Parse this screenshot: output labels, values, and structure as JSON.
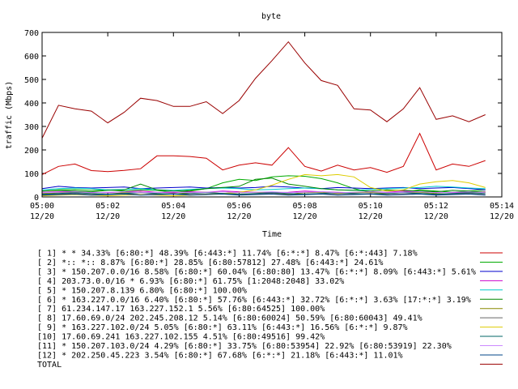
{
  "chart_data": {
    "type": "line",
    "title": "byte",
    "xlabel": "Time",
    "ylabel": "traffic (Mbps)",
    "ylim": [
      0,
      700
    ],
    "yticks": [
      0,
      100,
      200,
      300,
      400,
      500,
      600,
      700
    ],
    "xlim": [
      0,
      28
    ],
    "xticks": [
      {
        "x": 0,
        "label1": "05:00",
        "label2": "12/20"
      },
      {
        "x": 4,
        "label1": "05:02",
        "label2": "12/20"
      },
      {
        "x": 8,
        "label1": "05:04",
        "label2": "12/20"
      },
      {
        "x": 12,
        "label1": "05:06",
        "label2": "12/20"
      },
      {
        "x": 16,
        "label1": "05:08",
        "label2": "12/20"
      },
      {
        "x": 20,
        "label1": "05:10",
        "label2": "12/20"
      },
      {
        "x": 24,
        "label1": "05:12",
        "label2": "12/20"
      },
      {
        "x": 28,
        "label1": "05:14",
        "label2": "12/20"
      }
    ],
    "x": [
      0,
      1,
      2,
      3,
      4,
      5,
      6,
      7,
      8,
      9,
      10,
      11,
      12,
      13,
      14,
      15,
      16,
      17,
      18,
      19,
      20,
      21,
      22,
      23,
      24,
      25,
      26,
      27
    ],
    "series": [
      {
        "legend": "[ 1] * * 34.33%  [6:80:*] 48.39% [6:443:*] 11.74% [6:*:*] 8.47% [6:*:443] 7.18%",
        "color": "#cc0000",
        "values": [
          95,
          130,
          140,
          112,
          108,
          113,
          120,
          175,
          175,
          172,
          165,
          115,
          135,
          145,
          135,
          210,
          130,
          110,
          135,
          115,
          125,
          105,
          130,
          270,
          115,
          140,
          130,
          155
        ]
      },
      {
        "legend": "[ 2] *:: *:: 8.87%  [6:80:*] 28.85% [6:80:57812] 27.48% [6:443:*] 24.61%",
        "color": "#00aa00",
        "values": [
          25,
          30,
          32,
          28,
          30,
          25,
          30,
          28,
          20,
          25,
          35,
          60,
          75,
          70,
          85,
          90,
          88,
          78,
          60,
          35,
          20,
          15,
          20,
          30,
          25,
          20,
          25,
          30
        ]
      },
      {
        "legend": "[ 3] * 150.207.0.0/16 8.58%  [6:80:*] 60.04% [6:80:80] 13.47% [6:*:*] 8.09% [6:443:*] 5.61%",
        "color": "#0000cc",
        "values": [
          35,
          45,
          40,
          38,
          40,
          42,
          35,
          38,
          40,
          42,
          38,
          40,
          38,
          40,
          45,
          42,
          38,
          35,
          40,
          38,
          35,
          38,
          40,
          35,
          38,
          40,
          35,
          30
        ]
      },
      {
        "legend": "[ 4] 203.73.0.0/16 * 6.93%  [6:80:*] 61.75% [1:2048:2048] 33.02%",
        "color": "#cc00cc",
        "values": [
          20,
          22,
          25,
          20,
          18,
          22,
          25,
          20,
          18,
          22,
          20,
          25,
          22,
          20,
          18,
          20,
          25,
          22,
          20,
          18,
          22,
          20,
          25,
          22,
          20,
          18,
          20,
          22
        ]
      },
      {
        "legend": "[ 5] * 150.207.8.139 6.80%  [6:80:*] 100.00%",
        "color": "#00cccc",
        "values": [
          30,
          35,
          38,
          35,
          30,
          32,
          35,
          30,
          28,
          32,
          35,
          38,
          35,
          30,
          32,
          35,
          38,
          35,
          30,
          28,
          32,
          35,
          38,
          40,
          45,
          42,
          38,
          35
        ]
      },
      {
        "legend": "[ 6] * 163.227.0.0/16 6.40%  [6:80:*] 57.76% [6:443:*] 32.72% [6:*:*] 3.63% [17:*:*] 3.19%",
        "color": "#008800",
        "values": [
          25,
          28,
          25,
          22,
          28,
          30,
          55,
          30,
          25,
          28,
          35,
          40,
          45,
          75,
          80,
          55,
          45,
          35,
          30,
          28,
          25,
          30,
          28,
          25,
          22,
          28,
          25,
          20
        ]
      },
      {
        "legend": "[ 7] 61.234.147.17 163.227.152.1 5.56%  [6:80:64525] 100.00%",
        "color": "#888800",
        "values": [
          15,
          18,
          20,
          15,
          12,
          18,
          20,
          15,
          12,
          18,
          20,
          15,
          18,
          20,
          15,
          12,
          18,
          20,
          15,
          18,
          20,
          15,
          18,
          20,
          15,
          12,
          18,
          20
        ]
      },
      {
        "legend": "[ 8] 17.60.69.0/24 202.245.208.12 5.14%  [6:80:60024] 50.59% [6:80:60043] 49.41%",
        "color": "#666666",
        "values": [
          10,
          12,
          15,
          10,
          12,
          15,
          10,
          12,
          15,
          10,
          12,
          15,
          10,
          12,
          15,
          10,
          12,
          15,
          10,
          12,
          15,
          10,
          12,
          15,
          10,
          12,
          15,
          10
        ]
      },
      {
        "legend": "[ 9] * 163.227.102.0/24 5.05%  [6:80:*] 63.11% [6:443:*] 16.56% [6:*:*] 9.87%",
        "color": "#ddcc00",
        "values": [
          5,
          8,
          10,
          8,
          5,
          8,
          10,
          8,
          5,
          8,
          10,
          15,
          20,
          30,
          50,
          75,
          95,
          90,
          95,
          85,
          40,
          25,
          30,
          55,
          65,
          70,
          60,
          40
        ]
      },
      {
        "legend": "[10] 17.60.69.241 163.227.102.155 4.51%  [6:80:49516] 99.42%",
        "color": "#006666",
        "values": [
          12,
          15,
          18,
          15,
          12,
          15,
          18,
          15,
          12,
          15,
          18,
          15,
          12,
          15,
          18,
          15,
          12,
          15,
          18,
          15,
          12,
          15,
          18,
          15,
          12,
          15,
          18,
          15
        ]
      },
      {
        "legend": "[11] * 150.207.103.0/24 4.29%  [6:80:*] 33.75% [6:80:53954] 22.92% [6:80:53919] 22.30%",
        "color": "#cc88ff",
        "values": [
          18,
          20,
          22,
          18,
          20,
          22,
          18,
          20,
          22,
          18,
          20,
          22,
          18,
          20,
          22,
          18,
          20,
          22,
          18,
          20,
          22,
          18,
          20,
          22,
          18,
          20,
          22,
          18
        ]
      },
      {
        "legend": "[12] * 202.250.45.223 3.54%  [6:80:*] 67.68% [6:*:*] 21.18% [6:443:*] 11.01%",
        "color": "#004488",
        "values": [
          8,
          10,
          12,
          8,
          10,
          12,
          8,
          10,
          12,
          8,
          10,
          12,
          8,
          10,
          12,
          8,
          10,
          12,
          8,
          10,
          12,
          8,
          10,
          12,
          8,
          10,
          12,
          8
        ]
      },
      {
        "legend": "TOTAL",
        "color": "#990000",
        "values": [
          250,
          390,
          375,
          365,
          315,
          360,
          420,
          410,
          385,
          385,
          405,
          355,
          410,
          505,
          580,
          660,
          570,
          495,
          475,
          375,
          370,
          320,
          375,
          465,
          330,
          345,
          320,
          350
        ]
      }
    ]
  }
}
